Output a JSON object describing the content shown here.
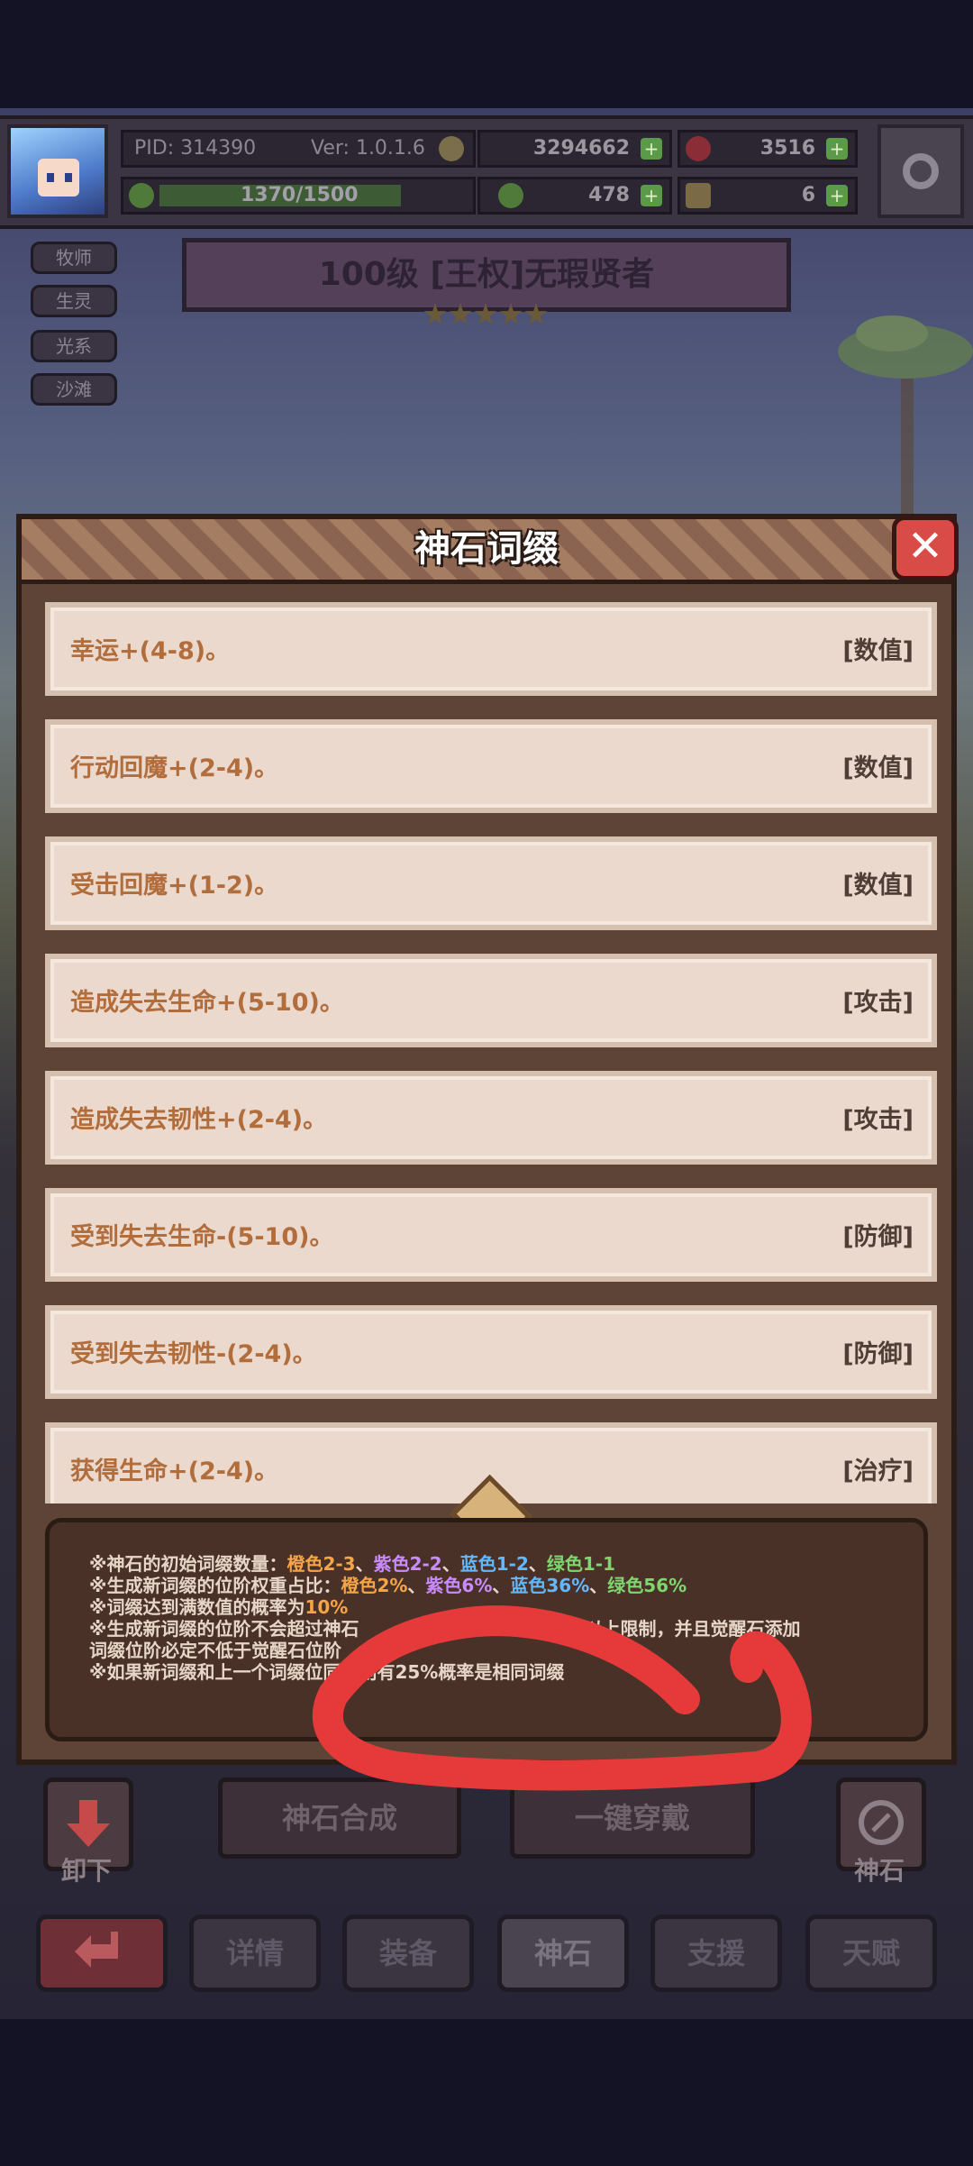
{
  "player": {
    "pid": "PID: 314390",
    "version": "Ver: 1.0.1.6",
    "gold": "3294662",
    "gems": "3516",
    "exp": "1370/1500",
    "clover": "478",
    "keys": "6"
  },
  "side_tags": [
    "牧师",
    "生灵",
    "光系",
    "沙滩"
  ],
  "character_title": "100级  [王权]无瑕贤者",
  "modal": {
    "title": "神石词缀",
    "close_icon": "close-icon",
    "affixes": [
      {
        "text": "幸运+(4-8)。",
        "category": "[数值]"
      },
      {
        "text": "行动回魔+(2-4)。",
        "category": "[数值]"
      },
      {
        "text": "受击回魔+(1-2)。",
        "category": "[数值]"
      },
      {
        "text": "造成失去生命+(5-10)。",
        "category": "[攻击]"
      },
      {
        "text": "造成失去韧性+(2-4)。",
        "category": "[攻击]"
      },
      {
        "text": "受到失去生命-(5-10)。",
        "category": "[防御]"
      },
      {
        "text": "受到失去韧性-(2-4)。",
        "category": "[防御]"
      },
      {
        "text": "获得生命+(2-4)。",
        "category": "[治疗]"
      }
    ],
    "info": {
      "l1_prefix": "※神石的初始词缀数量：",
      "l1_orange": "橙色2-3",
      "l1_purple": "紫色2-2",
      "l1_blue": "蓝色1-2",
      "l1_green": "绿色1-1",
      "sep": "、",
      "l2_prefix": "※生成新词缀的位阶权重占比：",
      "l2_orange": "橙色2%",
      "l2_purple": "紫色6%",
      "l2_blue": "蓝色36%",
      "l2_green": "绿色56%",
      "l3_prefix": "※词缀达到满数值的概率为",
      "l3_value": "10%",
      "l4a": "※生成新词缀的位阶不会超过神石",
      "l4b": "以上限制，并且觉醒石添加",
      "l5": "词缀位阶必定不低于觉醒石位阶",
      "l6a": "※如果新词缀和上一个词缀位",
      "l6b": "同，则有25%概率是相同词缀"
    }
  },
  "bottom": {
    "unequip": "卸下",
    "synthesize": "神石合成",
    "equip_all": "一键穿戴",
    "stone": "神石"
  },
  "tabs": [
    "详情",
    "装备",
    "神石",
    "支援",
    "天赋"
  ],
  "colors": {
    "annotation_red": "#e63a3a",
    "orange": "#f5a547",
    "purple": "#c98bff",
    "blue": "#62b8ff",
    "green": "#7ed66f"
  }
}
